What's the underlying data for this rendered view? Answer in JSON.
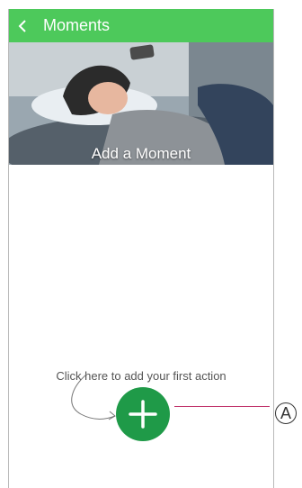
{
  "header": {
    "title": "Moments",
    "back_icon": "chevron-left-icon",
    "color": "#4dc95b"
  },
  "hero": {
    "label": "Add a Moment"
  },
  "main": {
    "hint_text": "Click here to add your first action",
    "add_button_icon": "plus-icon",
    "add_button_color": "#1f9a48"
  },
  "annotation": {
    "callout_label": "A",
    "line_color": "#c0326a"
  }
}
